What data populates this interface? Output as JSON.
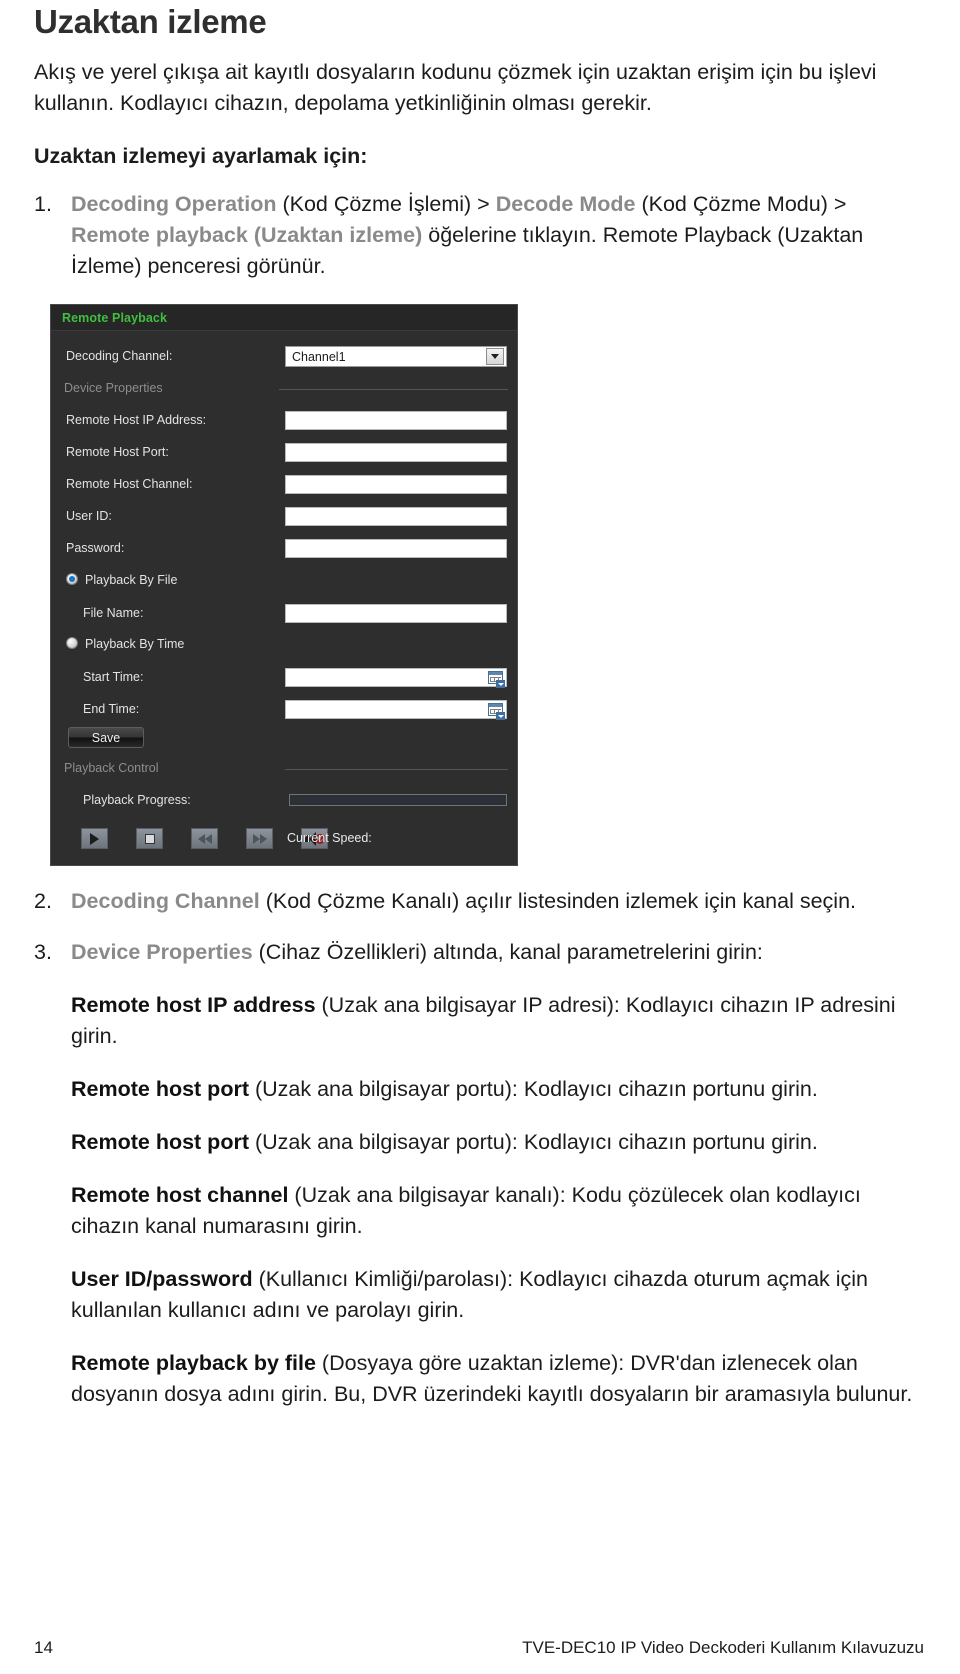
{
  "doc": {
    "title": "Uzaktan izleme",
    "intro": "Akış ve yerel çıkışa ait kayıtlı dosyaların kodunu çözmek için uzaktan erişim için bu işlevi kullanın. Kodlayıcı cihazın, depolama yetkinliğinin olması gerekir.",
    "subhead": "Uzaktan izlemeyi ayarlamak için:"
  },
  "steps": [
    {
      "num": "1.",
      "parts": [
        {
          "text": "Decoding Operation ",
          "style": "gray-bold"
        },
        {
          "text": " (Kod Çözme İşlemi) > ",
          "style": "plain"
        },
        {
          "text": "Decode Mode ",
          "style": "gray-bold"
        },
        {
          "text": " (Kod Çözme Modu) > ",
          "style": "plain"
        },
        {
          "text": "Remote playback (Uzaktan izleme)",
          "style": "gray-bold"
        },
        {
          "text": " öğelerine tıklayın. Remote Playback (Uzaktan İzleme) penceresi görünür.",
          "style": "plain"
        }
      ]
    },
    {
      "num": "2.",
      "parts": [
        {
          "text": "Decoding Channel",
          "style": "gray-bold"
        },
        {
          "text": " (Kod Çözme Kanalı) açılır listesinden izlemek için kanal seçin.",
          "style": "plain"
        }
      ]
    },
    {
      "num": "3.",
      "parts": [
        {
          "text": "Device Properties",
          "style": "gray-bold"
        },
        {
          "text": " (Cihaz Özellikleri) altında, kanal parametrelerini girin:",
          "style": "plain"
        }
      ]
    }
  ],
  "definitions": [
    {
      "term": "Remote host IP address",
      "body": " (Uzak ana bilgisayar IP adresi): Kodlayıcı cihazın IP adresini girin."
    },
    {
      "term": "Remote host port",
      "body": " (Uzak ana bilgisayar portu): Kodlayıcı cihazın portunu girin."
    },
    {
      "term": "Remote host port",
      "body": " (Uzak ana bilgisayar portu): Kodlayıcı cihazın portunu girin."
    },
    {
      "term": "Remote host channel",
      "body": " (Uzak ana bilgisayar kanalı): Kodu çözülecek olan kodlayıcı cihazın kanal numarasını girin."
    },
    {
      "term": "User ID/password",
      "body": " (Kullanıcı Kimliği/parolası): Kodlayıcı cihazda oturum açmak için kullanılan kullanıcı adını ve parolayı girin."
    },
    {
      "term": "Remote playback by file",
      "body": " (Dosyaya göre uzaktan izleme): DVR'dan izlenecek olan dosyanın dosya adını girin. Bu, DVR üzerindeki kayıtlı dosyaların bir aramasıyla bulunur."
    }
  ],
  "dialog": {
    "title": "Remote Playback",
    "title_color": "#3fbf3f",
    "background": "#2e2e2e",
    "decoding_channel": {
      "label": "Decoding Channel:",
      "value": "Channel1"
    },
    "device_properties_group": "Device Properties",
    "fields": [
      {
        "label": "Remote Host IP Address:",
        "value": ""
      },
      {
        "label": "Remote Host Port:",
        "value": ""
      },
      {
        "label": "Remote Host Channel:",
        "value": ""
      },
      {
        "label": "User ID:",
        "value": ""
      },
      {
        "label": "Password:",
        "value": ""
      }
    ],
    "playback_by_file": {
      "radio_label": "Playback By File",
      "selected": true,
      "file_name_label": "File Name:",
      "file_name_value": ""
    },
    "playback_by_time": {
      "radio_label": "Playback By Time",
      "selected": false,
      "start_time_label": "Start Time:",
      "start_time_value": "",
      "end_time_label": "End Time:",
      "end_time_value": ""
    },
    "save_label": "Save",
    "playback_control_group": "Playback Control",
    "playback_progress_label": "Playback Progress:",
    "playback_progress_value": "",
    "transport_icons": [
      "play-icon",
      "stop-icon",
      "rewind-icon",
      "fast-forward-icon",
      "mute-icon"
    ],
    "current_speed_label": "Current Speed:"
  },
  "footer": {
    "page_number": "14",
    "manual_title": "TVE-DEC10 IP Video Deckoderi Kullanım Kılavuzuzu"
  }
}
